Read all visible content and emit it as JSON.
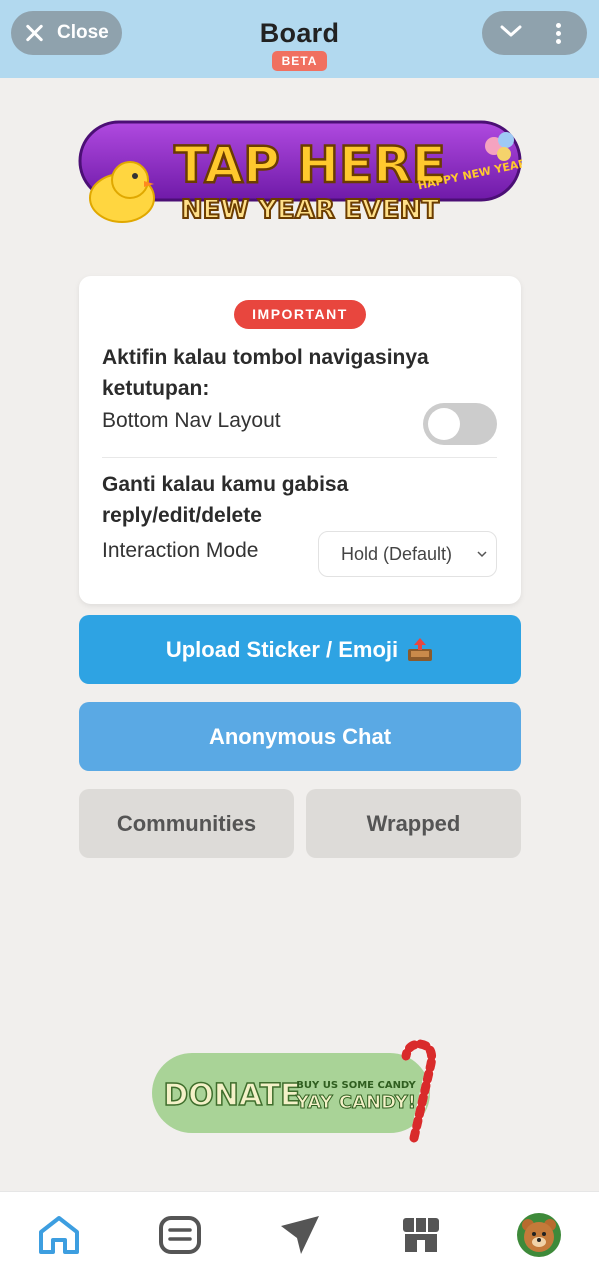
{
  "header": {
    "close_label": "Close",
    "title": "Board",
    "badge": "BETA"
  },
  "banner": {
    "line1": "TAP HERE",
    "line2": "NEW YEAR EVENT",
    "tag": "HAPPY NEW YEAR"
  },
  "card": {
    "badge": "IMPORTANT",
    "question1": "Aktifin kalau tombol navigasinya ketutupan:",
    "toggle_label": "Bottom Nav Layout",
    "toggle_on": false,
    "question2": "Ganti kalau kamu gabisa reply/edit/delete",
    "select_label": "Interaction Mode",
    "select_value": "Hold (Default)"
  },
  "buttons": {
    "upload": "Upload Sticker / Emoji",
    "anonymous": "Anonymous Chat",
    "communities": "Communities",
    "wrapped": "Wrapped"
  },
  "donate": {
    "label": "DONATE",
    "sub1": "BUY US SOME CANDY",
    "sub2": "YAY CANDY!"
  },
  "nav": {
    "items": [
      "home-icon",
      "chat-list-icon",
      "send-icon",
      "store-icon",
      "profile-avatar"
    ]
  },
  "colors": {
    "header_bg": "#b2d9ef",
    "accent_blue": "#2ea3e3",
    "important_red": "#e8463e",
    "beta_red": "#f07060"
  }
}
